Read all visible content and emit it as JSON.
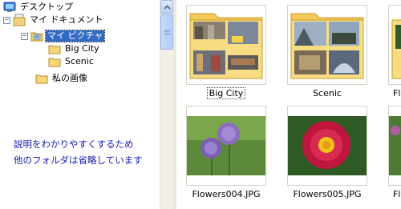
{
  "tree": {
    "desktop": "デスクトップ",
    "my_documents": "マイ ドキュメント",
    "my_pictures": "マイ ピクチャ",
    "big_city": "Big City",
    "scenic": "Scenic",
    "my_images": "私の画像"
  },
  "note": {
    "line1": "説明をわかりやすくするため",
    "line2": "他のフォルダは省略しています"
  },
  "files": [
    {
      "name": "Big City",
      "type": "folder"
    },
    {
      "name": "Scenic",
      "type": "folder"
    },
    {
      "name": "Fl",
      "type": "folder"
    },
    {
      "name": "Flowers004.JPG",
      "type": "image"
    },
    {
      "name": "Flowers005.JPG",
      "type": "image"
    },
    {
      "name": "Fl",
      "type": "image"
    }
  ],
  "colors": {
    "selection": "#316ac5",
    "note_text": "#1a1ab4",
    "folder_yellow": "#f6d679"
  },
  "icons": [
    "desktop-icon",
    "documents-icon",
    "pictures-folder-icon",
    "folder-icon",
    "scroll-up-arrow-icon"
  ]
}
